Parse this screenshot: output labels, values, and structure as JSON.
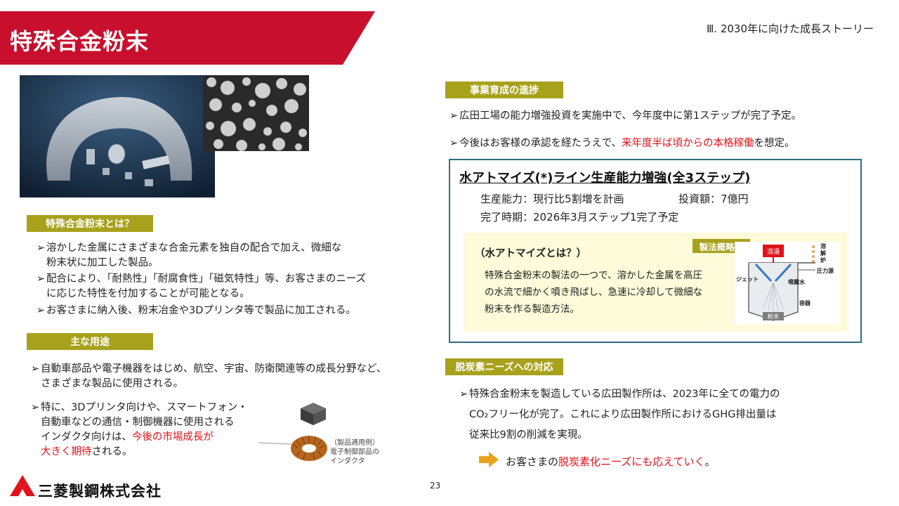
{
  "header": {
    "title": "特殊合金粉末",
    "section_ref": "Ⅲ. 2030年に向けた成長ストーリー",
    "band_color": "#c8102e"
  },
  "left": {
    "what_is": {
      "tag": "特殊合金粉末とは？",
      "bullets": [
        [
          "溶かした金属にさまざまな合金元素を独自の配合で加え、微細な",
          "粉末状に加工した製品。"
        ],
        [
          "配合により、「耐熱性」「耐腐食性」「磁気特性」等、お客さまのニーズ",
          "に応じた特性を付加することが可能となる。"
        ],
        [
          "お客さまに納入後、粉末冶金や3Dプリンタ等で製品に加工される。"
        ]
      ]
    },
    "uses": {
      "tag": "主な用途",
      "bullet1": [
        "自動車部品や電子機器をはじめ、航空、宇宙、防衛関連等の成長分野など、",
        "さまざまな製品に使用される。"
      ],
      "bullet2": {
        "line1": "特に、3Dプリンタ向けや、スマートフォン・",
        "line2": "自動車などの通信・制御機器に使用される",
        "line3_pre": "インダクタ向けは、",
        "line3_red": "今後の市場成長が",
        "line4_red": "大きく期待",
        "line4_post": "される。"
      },
      "caption": "（製品適用例）\n電子制御部品の\nインダクタ"
    }
  },
  "right": {
    "progress": {
      "tag": "事業育成の進捗",
      "bullet1": "広田工場の能力増強投資を実施中で、今年度中に第1ステップが完了予定。",
      "bullet2_pre": "今後はお客様の承認を経たうえで、",
      "bullet2_red": "来年度半ば頃からの本格稼働",
      "bullet2_post": "を想定。"
    },
    "box": {
      "title": "水アトマイズ(*)ライン生産能力増強(全3ステップ)",
      "capacity": "生産能力：現行比5割増を計画",
      "investment": "投資額：7億円",
      "completion": "完了時期：2026年3月ステップ1完了予定",
      "inner_heading": "（水アトマイズとは？）",
      "inner_body": [
        "特殊合金粉末の製法の一つで、溶かした金属を高圧",
        "の水流で細かく噴き飛ばし、急速に冷却して微細な",
        "粉末を作る製造方法。"
      ],
      "diagram_tag": "製法概略図",
      "diagram_labels": {
        "melt": "溶湯",
        "furnace": "溶解炉",
        "pressure": "圧力源",
        "jet": "ジェット",
        "spray": "噴霧水",
        "vessel": "容器",
        "powder": "粉末"
      }
    },
    "decarbon": {
      "tag": "脱炭素ニーズへの対応",
      "lines": [
        "特殊合金粉末を製造している広田製作所は、2023年に全ての電力の",
        "CO₂フリー化が完了。これにより広田製作所におけるGHG排出量は",
        "従来比9割の削減を実現。"
      ],
      "conclusion_pre": "お客さまの",
      "conclusion_red": "脱炭素化ニーズにも応えていく",
      "conclusion_post": "。"
    }
  },
  "footer": {
    "company": "三菱製鋼株式会社",
    "page": "23"
  },
  "colors": {
    "accent_red": "#e0121b",
    "tag_olive": "#a8a11c",
    "box_border": "#2f6f80",
    "inner_bg": "#fdfbd9"
  }
}
